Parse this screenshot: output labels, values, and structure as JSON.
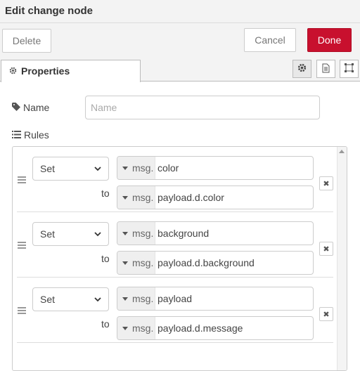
{
  "title": "Edit change node",
  "toolbar": {
    "delete_label": "Delete",
    "cancel_label": "Cancel",
    "done_label": "Done"
  },
  "tabs": {
    "properties_label": "Properties",
    "icons": [
      "gear-icon",
      "description-icon",
      "appearance-icon"
    ]
  },
  "name_field": {
    "label": "Name",
    "placeholder": "Name",
    "value": ""
  },
  "rules": {
    "label": "Rules",
    "items": [
      {
        "action": "Set",
        "target_prefix": "msg.",
        "target": "color",
        "to_label": "to",
        "source_prefix": "msg.",
        "source": "payload.d.color"
      },
      {
        "action": "Set",
        "target_prefix": "msg.",
        "target": "background",
        "to_label": "to",
        "source_prefix": "msg.",
        "source": "payload.d.background"
      },
      {
        "action": "Set",
        "target_prefix": "msg.",
        "target": "payload",
        "to_label": "to",
        "source_prefix": "msg.",
        "source": "payload.d.message"
      }
    ]
  },
  "colors": {
    "done_button": "#c8102e",
    "toolbar_bg": "#f3f3f3"
  }
}
